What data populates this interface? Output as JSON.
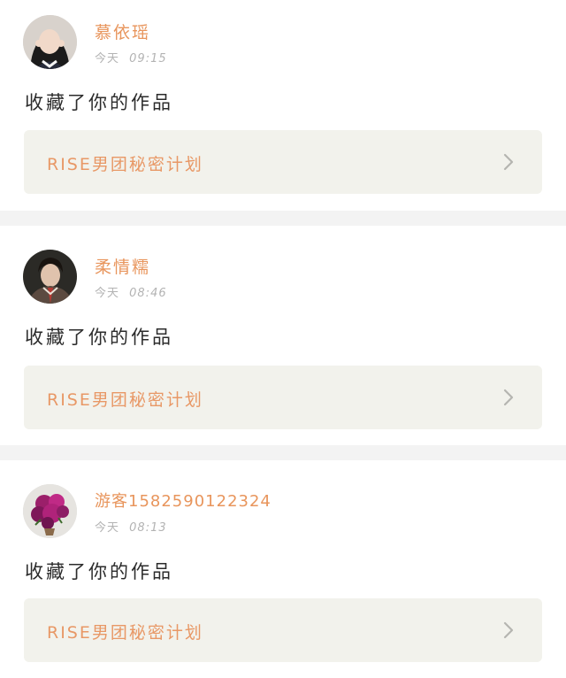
{
  "notifications": [
    {
      "user": "慕依瑶",
      "time_prefix": "今天",
      "time": "09:15",
      "action": "收藏了你的作品",
      "work_title": "RISE男团秘密计划",
      "avatar": "avatar-girl-photo"
    },
    {
      "user": "柔情糯",
      "time_prefix": "今天",
      "time": "08:46",
      "action": "收藏了你的作品",
      "work_title": "RISE男团秘密计划",
      "avatar": "avatar-boy-photo"
    },
    {
      "user": "游客1582590122324",
      "time_prefix": "今天",
      "time": "08:13",
      "action": "收藏了你的作品",
      "work_title": "RISE男团秘密计划",
      "avatar": "avatar-flower-photo"
    }
  ],
  "colors": {
    "name": "#e8955c",
    "work_title": "#e89866",
    "work_bg": "#f2f2ec",
    "separator": "#f3f3f3"
  },
  "icons": {
    "chevron": "chevron-right-icon"
  }
}
